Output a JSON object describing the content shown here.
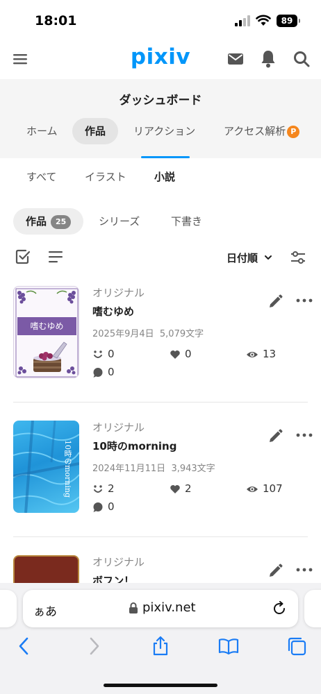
{
  "status_bar": {
    "time": "18:01",
    "battery": "89"
  },
  "header": {
    "logo": "pixiv"
  },
  "dashboard": {
    "title": "ダッシュボード",
    "tabs": [
      {
        "label": "ホーム"
      },
      {
        "label": "作品"
      },
      {
        "label": "リアクション"
      },
      {
        "label": "アクセス解析",
        "badge": "P"
      }
    ]
  },
  "subtabs": [
    {
      "label": "すべて"
    },
    {
      "label": "イラスト"
    },
    {
      "label": "小説"
    }
  ],
  "chips": [
    {
      "label": "作品",
      "count": "25"
    },
    {
      "label": "シリーズ"
    },
    {
      "label": "下書き"
    }
  ],
  "toolbar": {
    "sort_label": "日付順"
  },
  "works": [
    {
      "category": "オリジナル",
      "title": "嗜むゆめ",
      "cover_title": "嗜むゆめ",
      "date": "2025年9月4日",
      "chars": "5,079文字",
      "reactions": "0",
      "likes": "0",
      "views": "13",
      "comments": "0"
    },
    {
      "category": "オリジナル",
      "title": "10時のmorning",
      "cover_title": "10時のmorning",
      "date": "2024年11月11日",
      "chars": "3,943文字",
      "reactions": "2",
      "likes": "2",
      "views": "107",
      "comments": "0"
    },
    {
      "category": "オリジナル",
      "title": "ボフン！"
    }
  ],
  "browser": {
    "aa_label": "ぁあ",
    "domain": "pixiv.net"
  },
  "colors": {
    "brand": "#0096fa",
    "access_badge": "#f5861d",
    "divider": "#e6e6e6"
  }
}
